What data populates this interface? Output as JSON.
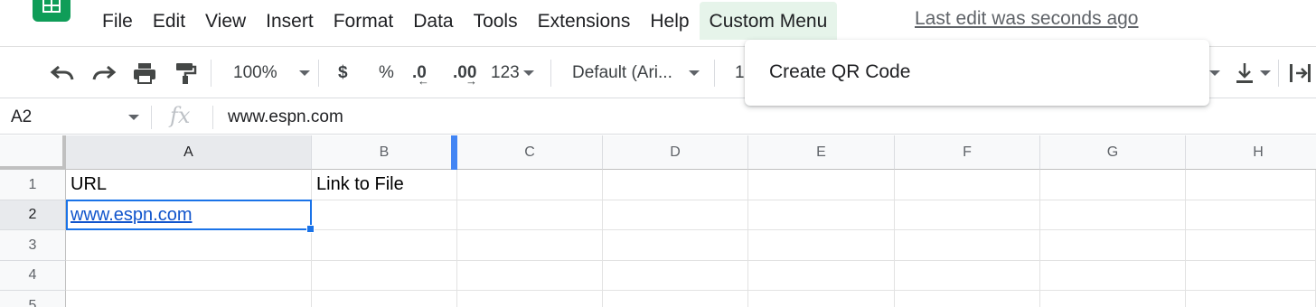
{
  "menubar": {
    "items": [
      "File",
      "Edit",
      "View",
      "Insert",
      "Format",
      "Data",
      "Tools",
      "Extensions",
      "Help",
      "Custom Menu"
    ],
    "last_edit": "Last edit was seconds ago"
  },
  "toolbar": {
    "zoom": "100%",
    "currency": "$",
    "percent": "%",
    "decrease_decimal": ".0",
    "increase_decimal": ".00",
    "more_formats": "123",
    "font": "Default (Ari...",
    "font_size_partial": "1"
  },
  "dropdown": {
    "items": [
      "Create QR Code"
    ]
  },
  "formula_bar": {
    "name_box": "A2",
    "fx": "fx",
    "value": "www.espn.com"
  },
  "grid": {
    "columns": [
      "A",
      "B",
      "C",
      "D",
      "E",
      "F",
      "G",
      "H"
    ],
    "rows": [
      "1",
      "2",
      "3",
      "4",
      "5"
    ],
    "cells": {
      "A1": "URL",
      "B1": "Link to File",
      "A2": "www.espn.com"
    },
    "selected_cell": "A2",
    "link_color": "#1155cc",
    "selection_color": "#1a73e8"
  },
  "colors": {
    "accent": "#0f9d58",
    "active_menu_bg": "#e6f4ea"
  }
}
